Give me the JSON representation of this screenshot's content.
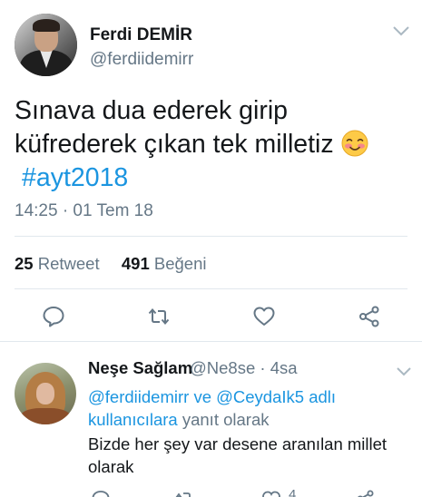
{
  "tweet": {
    "author_name": "Ferdi DEMİR",
    "author_handle": "@ferdiidemirr",
    "text": "Sınava dua ederek girip küfrederek çıkan tek milletiz",
    "hashtag": "#ayt2018",
    "emoji": "smiling-face-blushing",
    "timestamp": "14:25 · 01 Tem 18",
    "retweet_count": "25",
    "retweet_label": "Retweet",
    "like_count": "491",
    "like_label": "Beğeni",
    "actions": [
      "reply",
      "retweet",
      "like",
      "share"
    ]
  },
  "reply": {
    "author_name": "Neşe Sağlam",
    "author_handle": "@Ne8se",
    "time": "· 4sa",
    "replying_to_part1": "@ferdiidemirr ve @CeydaIk5 adlı",
    "replying_to_part2": "kullanıcılara",
    "replying_to_suffix": "yanıt olarak",
    "text": "Bizde her şey var desene aranılan millet olarak",
    "like_count_partial": "4"
  },
  "colors": {
    "link": "#1b95e0",
    "secondary_text": "#657786",
    "primary_text": "#14171a",
    "divider": "#e1e8ed"
  }
}
